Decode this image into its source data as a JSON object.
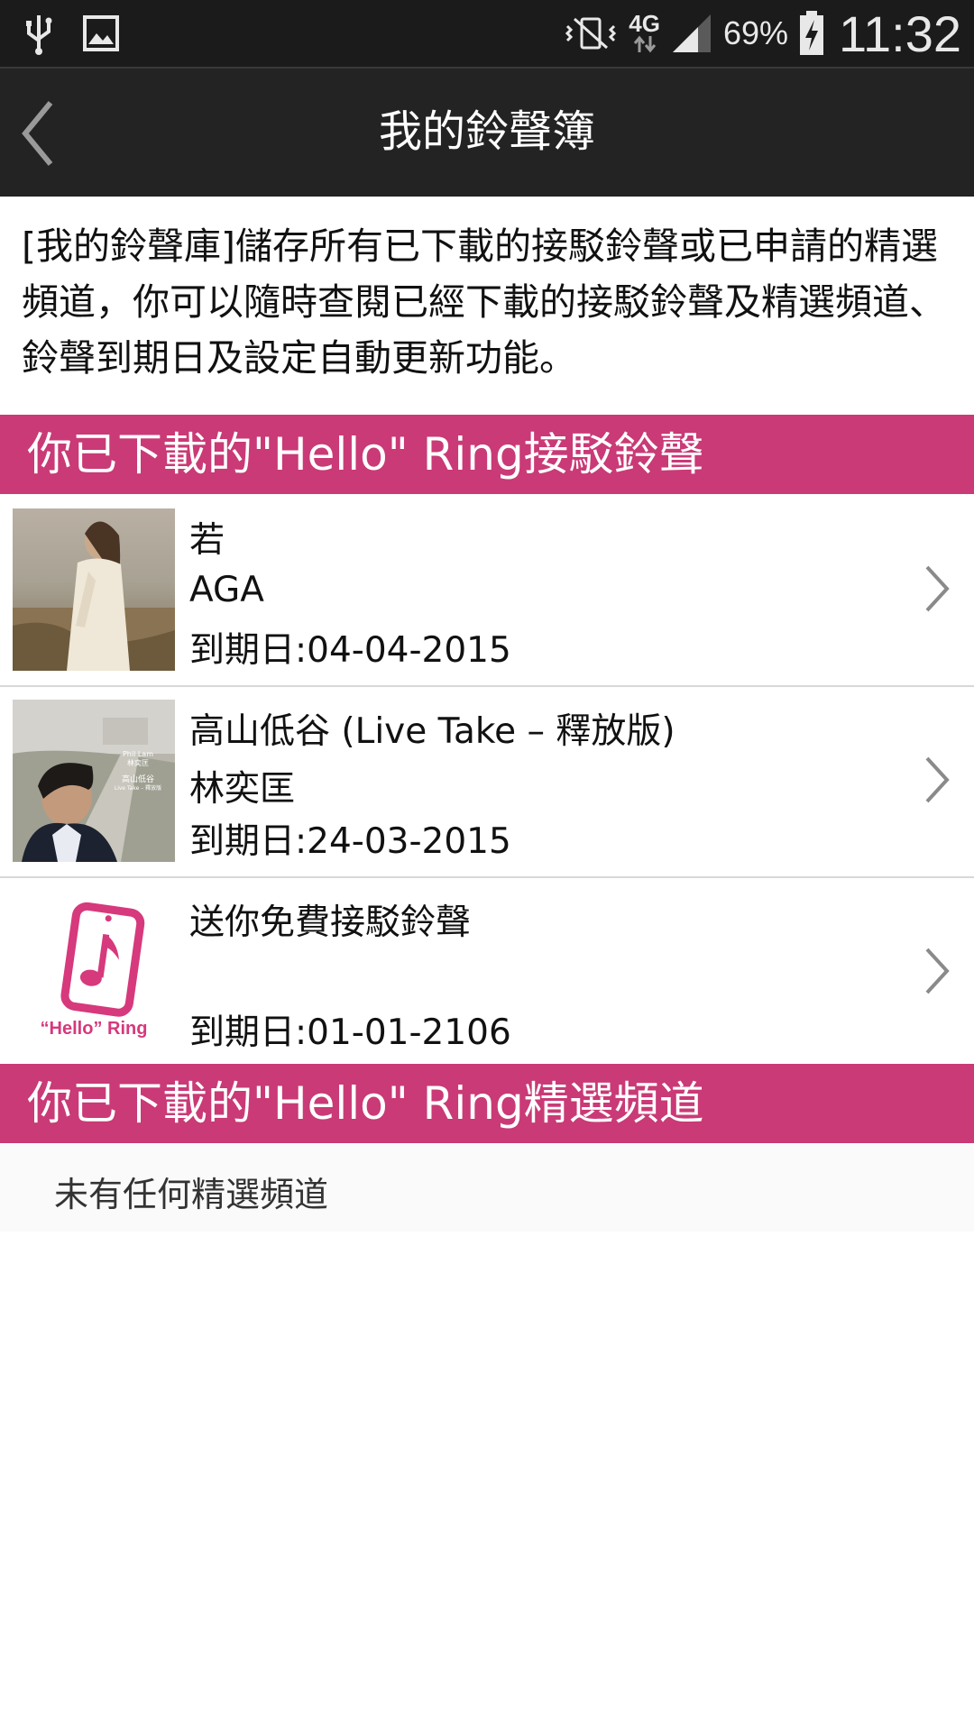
{
  "status_bar": {
    "network": "4G",
    "battery": "69%",
    "time": "11:32",
    "icons": [
      "usb-icon",
      "image-icon",
      "vibrate-icon",
      "data-arrows-icon",
      "signal-icon",
      "battery-charging-icon"
    ]
  },
  "app_bar": {
    "title": "我的鈴聲簿",
    "back_icon": "chevron-left-icon"
  },
  "intro": {
    "text": "[我的鈴聲庫]儲存所有已下載的接駁鈴聲或已申請的精選頻道，你可以隨時查閱已經下載的接駁鈴聲及精選頻道、鈴聲到期日及設定自動更新功能。"
  },
  "sections": {
    "ringtones_header": "你已下載的\"Hello\" Ring接駁鈴聲",
    "channels_header": "你已下載的\"Hello\" Ring精選頻道",
    "channels_empty": "未有任何精選頻道"
  },
  "ringtones": [
    {
      "title": "若",
      "artist": "AGA",
      "expiry": "到期日:04-04-2015"
    },
    {
      "title": "高山低谷 (Live Take – 釋放版)",
      "artist": "林奕匡",
      "expiry": "到期日:24-03-2015",
      "cover_text": [
        "Phil Lam",
        "林奕匡",
        "高山低谷",
        "Live Take – 釋放版"
      ]
    },
    {
      "title": "送你免費接駁鈴聲",
      "artist": "",
      "expiry": "到期日:01-01-2106",
      "logo_text": "“Hello” Ring"
    }
  ],
  "colors": {
    "accent": "#c93a76",
    "status_bar": "#1b1b1b",
    "app_bar": "#232323"
  }
}
